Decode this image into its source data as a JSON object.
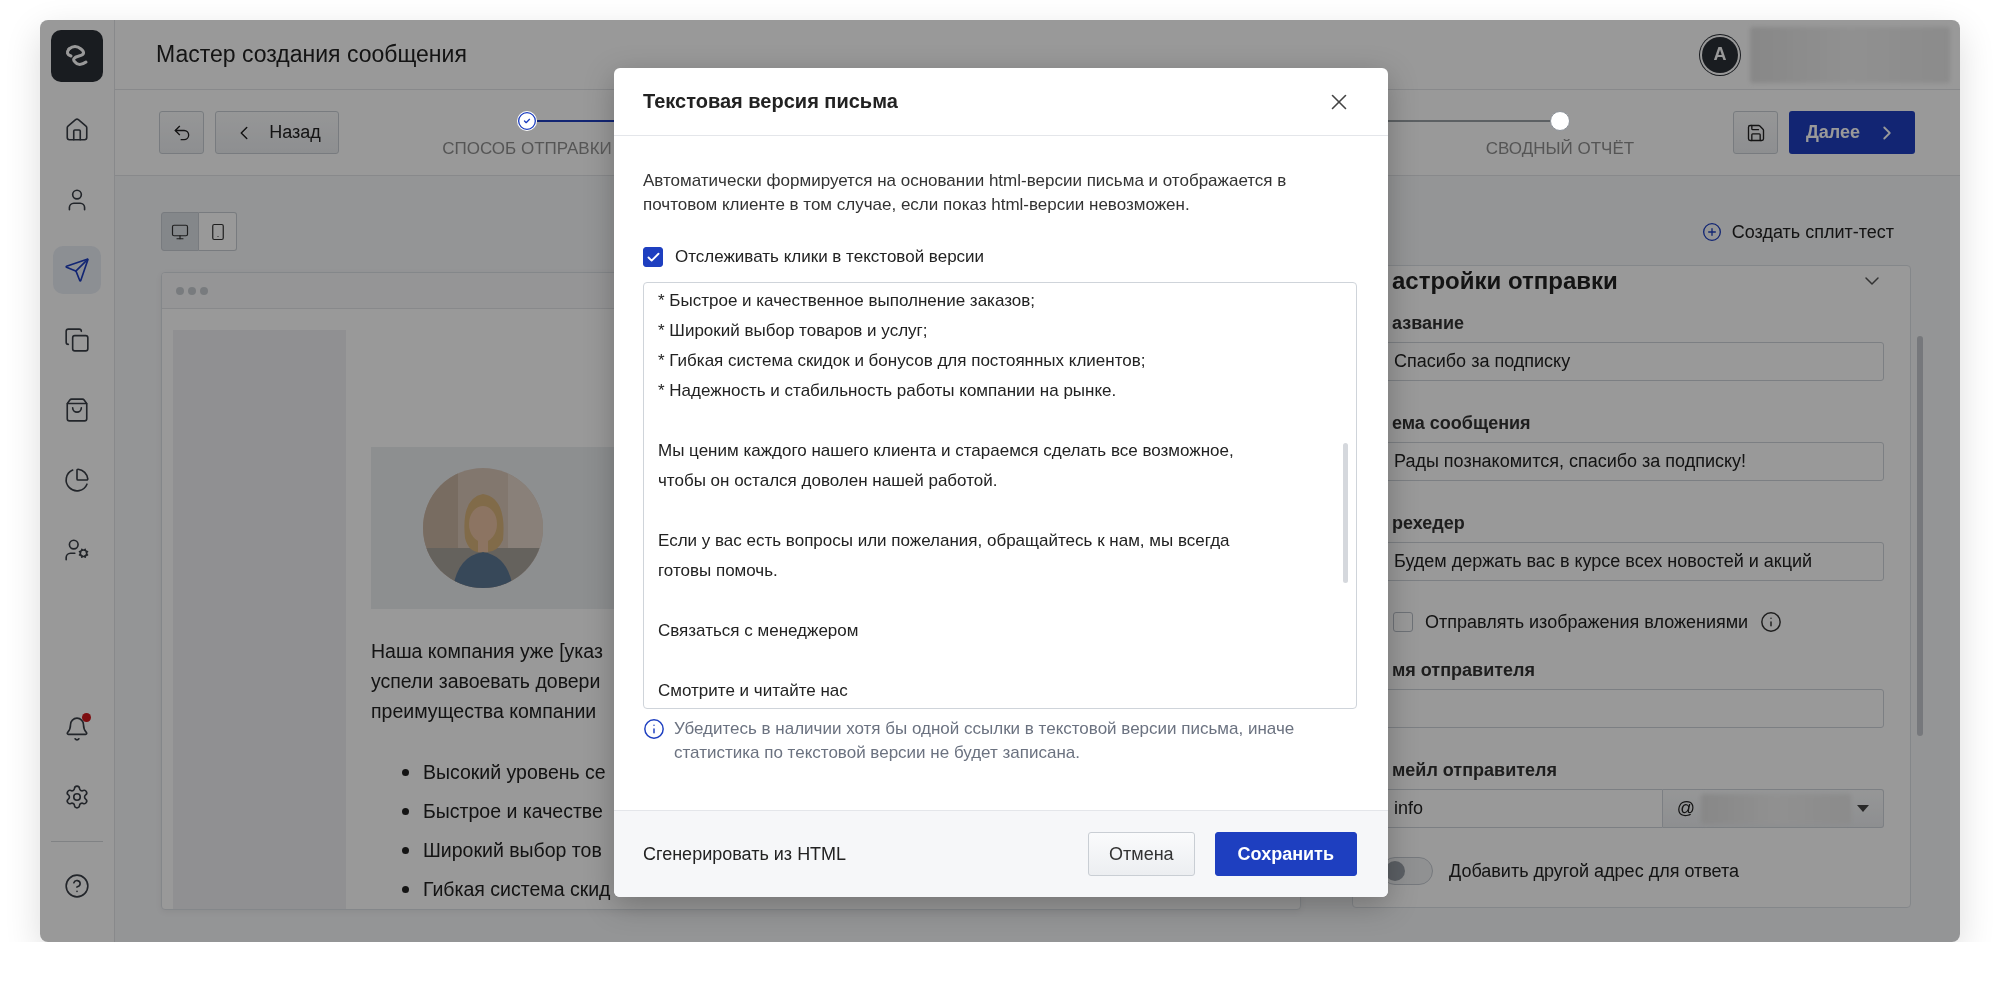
{
  "app": {
    "title": "Мастер создания сообщения",
    "user_initial": "A"
  },
  "sidebar": {
    "items": [
      {
        "selected": false
      },
      {
        "selected": false
      },
      {
        "selected": true
      },
      {
        "selected": false
      },
      {
        "selected": false
      },
      {
        "selected": false
      },
      {
        "selected": false
      }
    ],
    "bottom_items": [
      {
        "selected": false,
        "notification": true
      },
      {
        "selected": false
      },
      {
        "selected": false
      }
    ]
  },
  "toolbar": {
    "back_label": "Назад",
    "next_label": "Далее"
  },
  "stepper": {
    "steps": [
      {
        "label": "СПОСОБ ОТПРАВКИ",
        "done": true
      },
      {
        "label": "СВОДНЫЙ ОТЧЁТ",
        "done": false
      }
    ]
  },
  "preview": {
    "view_modes": [
      {
        "kind": "desktop",
        "selected": true
      },
      {
        "kind": "mobile",
        "selected": false
      }
    ],
    "hero": {
      "kind": "picture"
    },
    "paragraph_lines": [
      "Наша компания уже [указ",
      "успели завоевать довери",
      "преимущества компании"
    ],
    "bullets": [
      "Высокий уровень се",
      "Быстрое и качестве",
      "Широкий выбор тов",
      "Гибкая система скид"
    ]
  },
  "split_test": "Создать сплит-тест",
  "settings": {
    "title": "астройки отправки",
    "fields": [
      {
        "kind": "text",
        "label": "азвание",
        "value": "Спасибо за подписку"
      },
      {
        "kind": "text",
        "label": "ема сообщения",
        "value": "Рады познакомится, спасибо за подписку!"
      },
      {
        "kind": "text",
        "label": "рехедер",
        "value": "Будем держать вас в курсе всех новостей и акций"
      },
      {
        "kind": "checkbox",
        "label": "Отправлять изображения вложениями",
        "checked": false
      },
      {
        "kind": "text",
        "label": "мя отправителя"
      },
      {
        "kind": "email",
        "label": "мейл отправителя",
        "value": "info",
        "domain_prefix": "@"
      },
      {
        "kind": "toggle",
        "label": "Добавить другой адрес для ответа",
        "on": false
      }
    ]
  },
  "dialog": {
    "title": "Текстовая версия письма",
    "description": "Автоматически формируется на основании html-версии письма и отображается в почтовом клиенте в том случае, если показ html-версии невозможен.",
    "track_clicks": {
      "label": "Отслеживать клики в текстовой версии",
      "checked": true
    },
    "text_version": "* Быстрое и качественное выполнение заказов;\n* Широкий выбор товаров и услуг;\n* Гибкая система скидок и бонусов для постоянных клиентов;\n* Надежность и стабильность работы компании на рынке.\n\nМы ценим каждого нашего клиента и стараемся сделать все возможное,\nчтобы он остался доволен нашей работой.\n\nЕсли у вас есть вопросы или пожелания, обращайтесь к нам, мы всегда\nготовы помочь.\n\nСвязаться с менеджером\n\nСмотрите и читайте нас",
    "note": "Убедитесь в наличии хотя бы одной ссылки в текстовой версии письма, иначе статистика по текстовой версии не будет записана.",
    "generate_label": "Сгенерировать из HTML",
    "buttons": [
      {
        "kind": "secondary",
        "label": "Отмена"
      },
      {
        "kind": "primary",
        "label": "Сохранить"
      }
    ]
  }
}
